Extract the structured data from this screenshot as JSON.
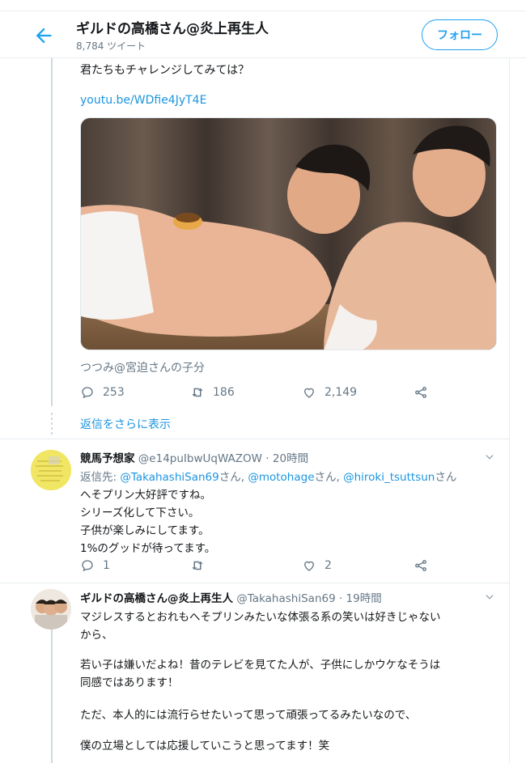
{
  "header": {
    "title": "ギルドの高橋さん@炎上再生人",
    "tweet_count": "8,784 ツイート",
    "follow_label": "フォロー"
  },
  "main_tweet": {
    "text_line": "君たちもチャレンジしてみては？",
    "link": "youtu.be/WDfie4JyT4E",
    "liked_by": "つつみ@宮迫さんの子分",
    "reply_count": "253",
    "retweet_count": "186",
    "like_count": "2,149"
  },
  "show_more_replies": "返信をさらに表示",
  "reply1": {
    "name": "競馬予想家",
    "handle_time": "@e14puIbwUqWAZOW · 20時間",
    "reply_to_prefix": "返信先: ",
    "reply_to_1": "@TakahashiSan69",
    "sep1": "さん, ",
    "reply_to_2": "@motohage",
    "sep2": "さん, ",
    "reply_to_3": "@hiroki_tsuttsun",
    "sep3": "さん",
    "lines": [
      "へそプリン大好評ですね。",
      "シリーズ化して下さい。",
      "子供が楽しみにしてます。",
      "1%のグッドが待ってます。"
    ],
    "reply_count": "1",
    "retweet_count": "",
    "like_count": "2"
  },
  "reply2": {
    "name": "ギルドの高橋さん@炎上再生人",
    "handle_time": "@TakahashiSan69 · 19時間",
    "lines": [
      "マジレスするとおれもへそプリンみたいな体張る系の笑いは好きじゃない",
      "から、",
      "",
      "若い子は嫌いだよね！昔のテレビを見てた人が、子供にしかウケなそうは",
      "同感ではあります！",
      "",
      "ただ、本人的には流行らせたいって思って頑張ってるみたいなので、",
      "",
      "僕の立場としては応援していこうと思ってます！笑"
    ]
  },
  "colors": {
    "accent": "#1da1f2",
    "link": "#1b95e0",
    "muted": "#657786"
  }
}
